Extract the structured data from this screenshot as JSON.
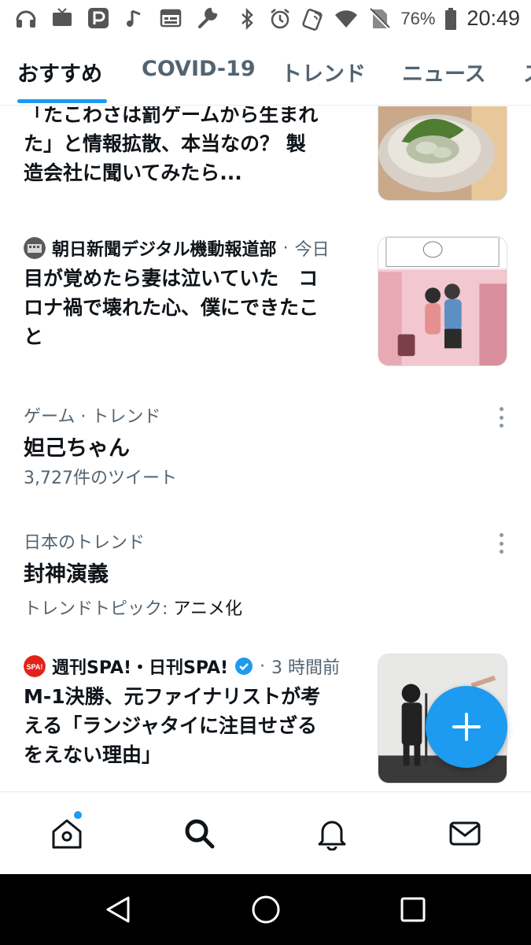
{
  "status_bar": {
    "left_icons": [
      "headphones-icon",
      "tv-icon",
      "parking-app-icon",
      "music-note-icon",
      "calendar-icon",
      "wrench-icon"
    ],
    "right_icons": [
      "bluetooth-icon",
      "alarm-icon",
      "nfc-icon",
      "wifi-icon",
      "no-sim-icon",
      "battery-icon"
    ],
    "battery": "76%",
    "time": "20:49"
  },
  "tabs": [
    {
      "label": "おすすめ",
      "active": true
    },
    {
      "label": "COVID-19",
      "active": false
    },
    {
      "label": "トレンド",
      "active": false
    },
    {
      "label": "ニュース",
      "active": false
    },
    {
      "label": "ス",
      "active": false
    }
  ],
  "feed": {
    "news1": {
      "title_lines": [
        "「たこわさは罰ゲームから生まれ",
        "た」と情報拡散、本当なの？ 製",
        "造会社に聞いてみたら..."
      ]
    },
    "news2": {
      "source": "朝日新聞デジタル機動報道部",
      "separator": "·",
      "time": "今日",
      "title_lines": [
        "目が覚めたら妻は泣いていた　コ",
        "ロナ禍で壊れた心、僕にできたこ",
        "と"
      ]
    },
    "trend1": {
      "category": "ゲーム · トレンド",
      "name": "妲己ちゃん",
      "count": "3,727件のツイート"
    },
    "trend2": {
      "category": "日本のトレンド",
      "name": "封神演義",
      "topic_label": "トレンドトピック:",
      "topic_value": "アニメ化"
    },
    "news3": {
      "avatar_text": "SPA!",
      "source": "週刊SPA!・日刊SPA!",
      "verified": true,
      "separator": "·",
      "time": "3 時間前",
      "title_lines": [
        "M-1決勝、元ファイナリストが考",
        "える「ランジャタイに注目せざる",
        "をえない理由」"
      ]
    }
  },
  "bottom_nav": [
    "home-icon",
    "search-icon",
    "notifications-icon",
    "messages-icon"
  ],
  "android_nav": [
    "back-icon",
    "home-circle-icon",
    "recents-icon"
  ],
  "colors": {
    "accent": "#1d9bf0",
    "text": "#0f1419",
    "secondary": "#536471"
  }
}
